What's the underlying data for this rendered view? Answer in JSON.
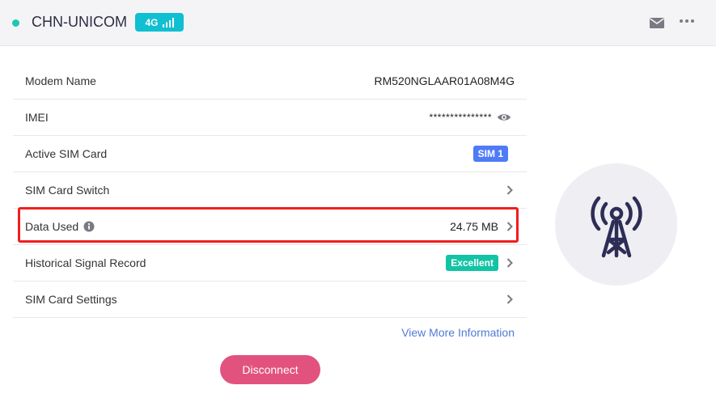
{
  "header": {
    "carrier": "CHN-UNICOM",
    "network_type": "4G",
    "icons": {
      "status": "status-dot",
      "signal": "signal-bars-icon",
      "mail": "mail-icon",
      "more": "more-icon"
    }
  },
  "rows": {
    "modem_name": {
      "label": "Modem Name",
      "value": "RM520NGLAAR01A08M4G"
    },
    "imei": {
      "label": "IMEI",
      "value": "***************"
    },
    "active_sim": {
      "label": "Active SIM Card",
      "value": "SIM 1"
    },
    "sim_switch": {
      "label": "SIM Card Switch"
    },
    "data_used": {
      "label": "Data Used",
      "value": "24.75 MB"
    },
    "signal_record": {
      "label": "Historical Signal Record",
      "value": "Excellent"
    },
    "sim_settings": {
      "label": "SIM Card Settings"
    }
  },
  "links": {
    "view_more": "View More Information"
  },
  "actions": {
    "disconnect": "Disconnect"
  },
  "colors": {
    "accent_teal": "#10bfd1",
    "sim_badge": "#4f7bf7",
    "excellent_badge": "#12c4a5",
    "disconnect": "#e2527f",
    "highlight": "#f01e1e",
    "link": "#4f7bd6",
    "tower": "#2d2d55"
  }
}
